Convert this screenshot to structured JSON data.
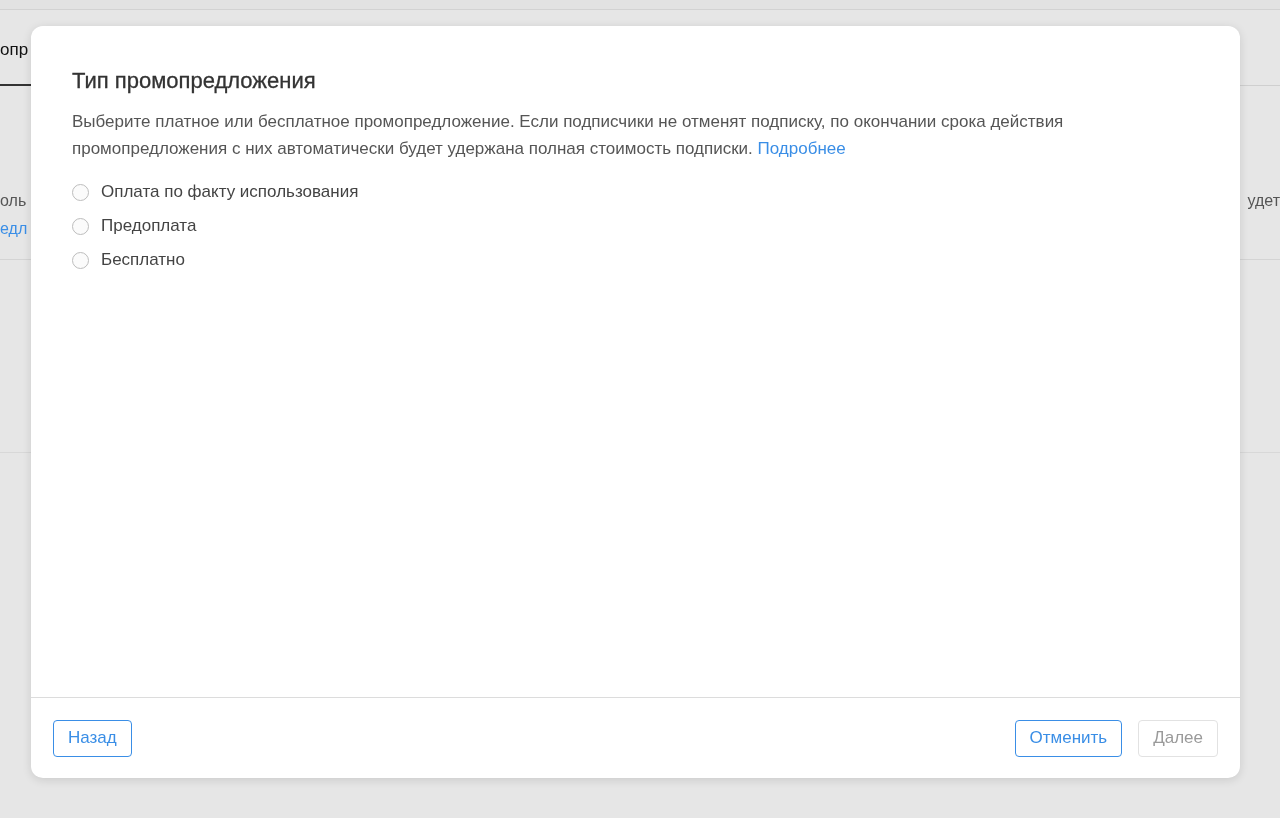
{
  "background": {
    "tab": {
      "label": "опр",
      "selected": true
    },
    "left_texts": [
      {
        "text": "оль",
        "kind": "plain"
      },
      {
        "text": "едл",
        "kind": "link"
      }
    ],
    "right_text": "удет"
  },
  "dialog": {
    "title": "Тип промопредложения",
    "description": "Выберите платное или бесплатное промопредложение. Если подписчики не отменят подписку, по окончании срока действия промопредложения с них автоматически будет удержана полная стоимость подписки.",
    "more_link": "Подробнее",
    "options": [
      {
        "label": "Оплата по факту использования",
        "selected": false
      },
      {
        "label": "Предоплата",
        "selected": false
      },
      {
        "label": "Бесплатно",
        "selected": false
      }
    ],
    "buttons": {
      "back": {
        "label": "Назад",
        "disabled": false
      },
      "cancel": {
        "label": "Отменить",
        "disabled": false
      },
      "next": {
        "label": "Далее",
        "disabled": true
      }
    }
  }
}
